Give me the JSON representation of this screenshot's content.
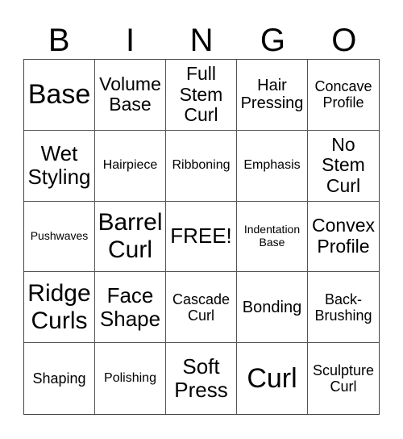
{
  "header": [
    "B",
    "I",
    "N",
    "G",
    "O"
  ],
  "cells": [
    "Base",
    "Volume Base",
    "Full Stem Curl",
    "Hair Pressing",
    "Concave Profile",
    "Wet Styling",
    "Hairpiece",
    "Ribboning",
    "Emphasis",
    "No Stem Curl",
    "Pushwaves",
    "Barrel Curl",
    "FREE!",
    "Indentation Base",
    "Convex Profile",
    "Ridge Curls",
    "Face Shape",
    "Cascade Curl",
    "Bonding",
    "Back-Brushing",
    "Shaping",
    "Polishing",
    "Soft Press",
    "Curl",
    "Sculpture Curl"
  ]
}
